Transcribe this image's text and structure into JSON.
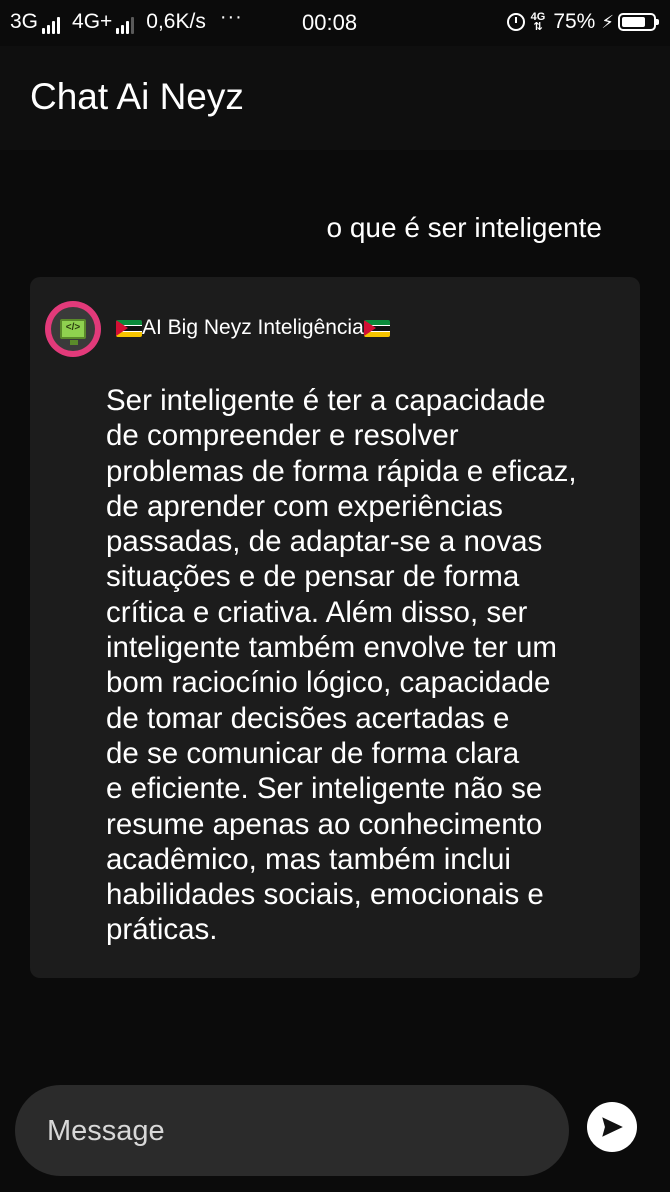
{
  "status_bar": {
    "network1": "3G",
    "network2": "4G+",
    "speed": "0,6K/s",
    "more": "···",
    "time": "00:08",
    "net_small": "4G",
    "battery": "75%"
  },
  "header": {
    "title": "Chat Ai Neyz"
  },
  "chat": {
    "user_message": "o que é ser inteligente",
    "bot": {
      "name": "AI Big Neyz Inteligência",
      "avatar_icon": "computer-code-icon",
      "message": "Ser inteligente é ter a capacidade\nde compreender e resolver\nproblemas de forma rápida e eficaz,\nde aprender com experiências\npassadas, de adaptar-se a novas\nsituações e de pensar de forma\ncrítica e criativa. Além disso, ser\ninteligente também envolve ter um\nbom raciocínio lógico, capacidade\nde tomar decisões acertadas e\nde se comunicar de forma clara\ne eficiente. Ser inteligente não se\nresume apenas ao conhecimento\nacadêmico, mas também inclui\nhabilidades sociais, emocionais e\npráticas."
    }
  },
  "composer": {
    "placeholder": "Message",
    "value": "",
    "send_icon": "send-icon"
  },
  "colors": {
    "background": "#0b0b0b",
    "card": "#1c1c1c",
    "input": "#2b2b2b",
    "avatar_ring": "#e23a7a"
  }
}
